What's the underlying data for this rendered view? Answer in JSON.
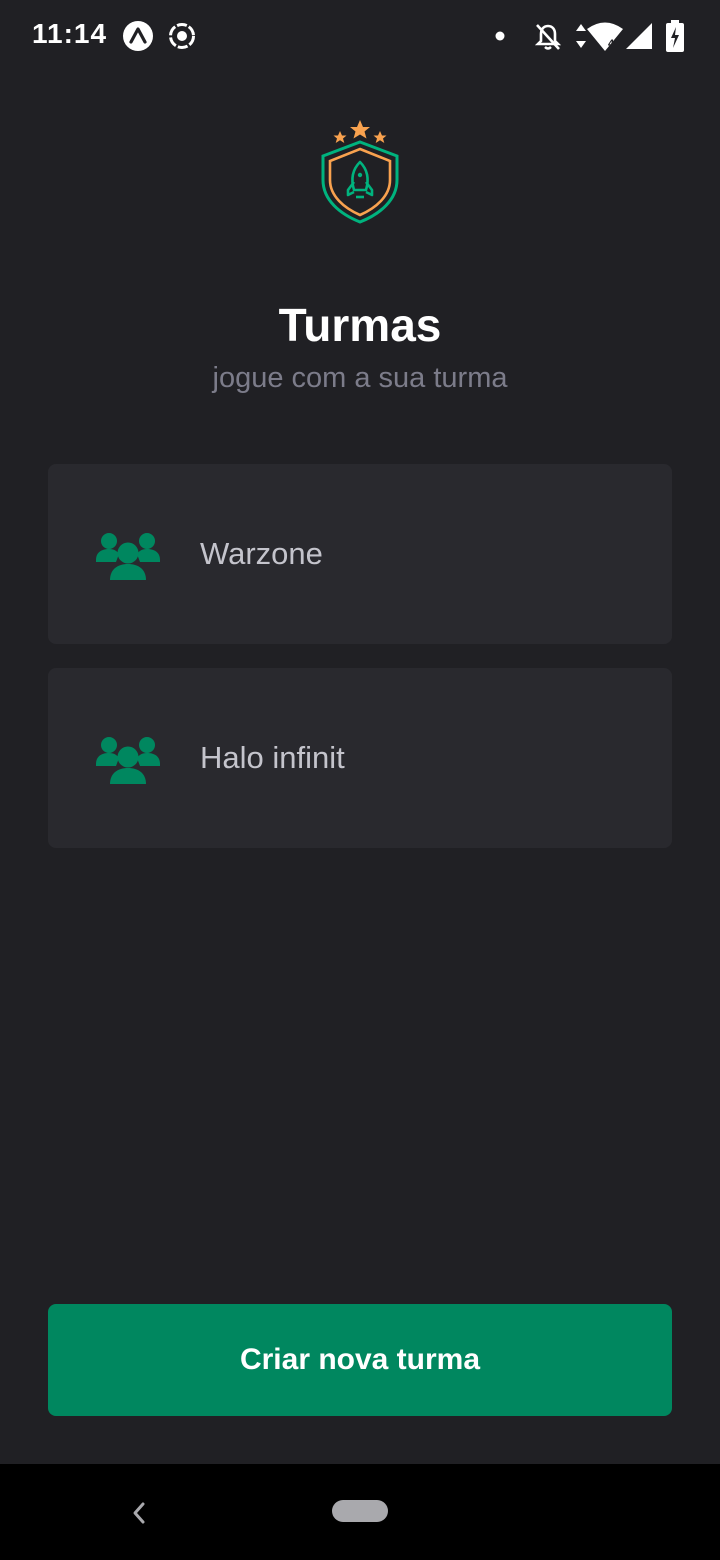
{
  "status_bar": {
    "time": "11:14",
    "left_icons": [
      "expo-go-icon",
      "screen-record-icon"
    ],
    "right_icons": [
      "notification-dot-icon",
      "bell-off-icon",
      "data-arrows-icon",
      "wifi-icon",
      "cell-signal-icon",
      "battery-charging-icon"
    ],
    "wifi_badge": "4"
  },
  "header": {
    "logo_icon": "shield-rocket-stars-icon",
    "title": "Turmas",
    "subtitle": "jogue com a sua turma"
  },
  "groups": [
    {
      "name": "Warzone",
      "icon": "users-three-icon"
    },
    {
      "name": "Halo infinit",
      "icon": "users-three-icon"
    }
  ],
  "actions": {
    "create_group_label": "Criar nova turma"
  },
  "nav_bar": {
    "icons": [
      "back-icon",
      "home-pill-icon"
    ]
  },
  "colors": {
    "background": "#202024",
    "card": "#29292e",
    "accent_green": "#00875f",
    "star_orange": "#f9a24f",
    "shield_green": "#00b37e",
    "title_white": "#ffffff",
    "subtitle_gray": "#7c7c8a",
    "label_gray": "#c4c4cc"
  }
}
